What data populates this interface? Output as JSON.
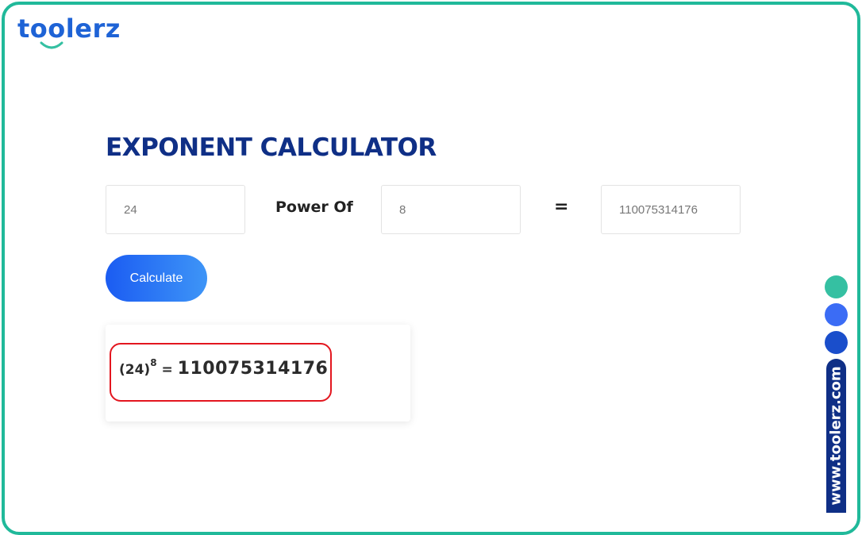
{
  "brand": {
    "logo_text": "toolerz",
    "vertical_url": "www.toolerz.com",
    "colors": {
      "frame": "#20b99a",
      "logo": "#1e63d6",
      "title": "#0f2f86",
      "button_start": "#1b5cf2",
      "button_end": "#3e95f7",
      "highlight": "#e3161f",
      "dot_teal": "#35c0a2",
      "dot_blue": "#3b6cf5",
      "dot_navy": "#1a4ecb"
    }
  },
  "calculator": {
    "title": "EXPONENT CALCULATOR",
    "base_value": "24",
    "power_label": "Power Of",
    "exponent_value": "8",
    "equals_sign": "=",
    "result_value": "110075314176",
    "calculate_label": "Calculate"
  },
  "result_display": {
    "base": "(24)",
    "exponent": "8",
    "equals": " = ",
    "value": "110075314176"
  }
}
